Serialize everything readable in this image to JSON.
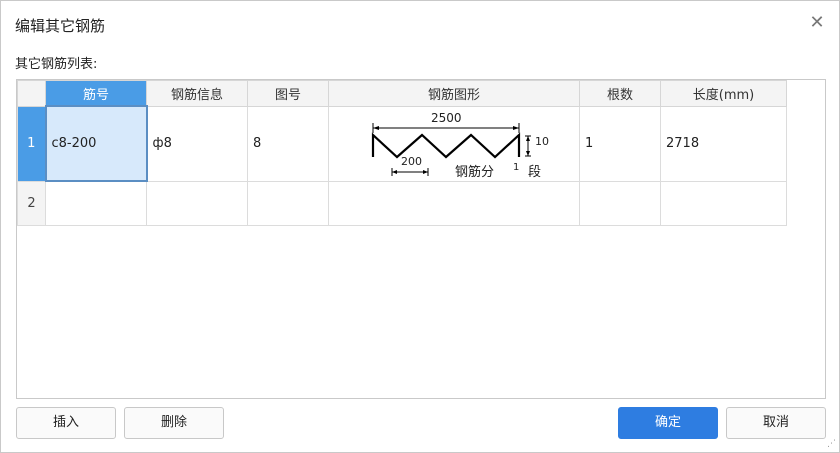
{
  "dialog": {
    "title": "编辑其它钢筋",
    "list_label": "其它钢筋列表:"
  },
  "table": {
    "columns": [
      "筋号",
      "钢筋信息",
      "图号",
      "钢筋图形",
      "根数",
      "长度(mm)"
    ],
    "rows": [
      {
        "num": "1",
        "rebar_no": "c8-200",
        "info": "ф8",
        "figure_no": "8",
        "shape": {
          "top_dim": "2500",
          "bottom_dim": "200",
          "height_dim": "10",
          "segments_label": "钢筋分",
          "segments_count": "1",
          "segments_suffix": "段"
        },
        "count": "1",
        "length": "2718"
      },
      {
        "num": "2",
        "rebar_no": "",
        "info": "",
        "figure_no": "",
        "count": "",
        "length": ""
      }
    ]
  },
  "buttons": {
    "insert": "插入",
    "delete": "删除",
    "ok": "确定",
    "cancel": "取消"
  },
  "icons": {
    "close": "close-icon",
    "resize": "resize-grip-icon"
  },
  "colors": {
    "accent": "#2e7de1",
    "header_active": "#4a9ce6",
    "selected_cell": "#d7e9fb"
  }
}
